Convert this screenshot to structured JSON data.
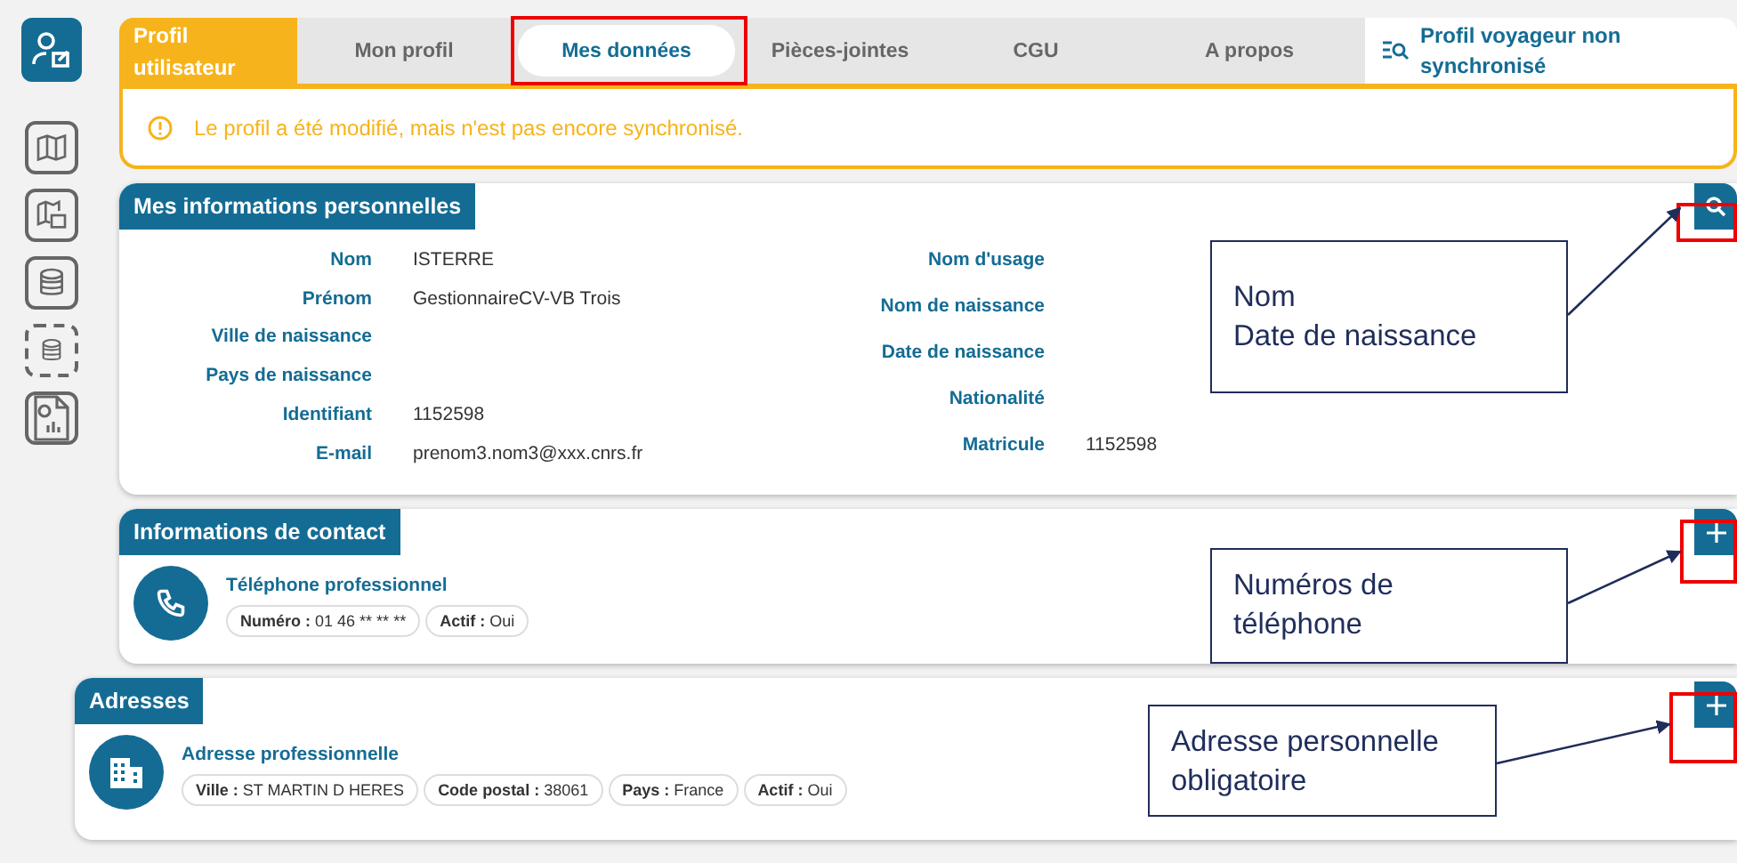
{
  "sidebar": {
    "items": [
      {
        "kind": "user",
        "selected": true
      },
      {
        "kind": "map",
        "selected": false
      },
      {
        "kind": "calendar",
        "selected": false
      },
      {
        "kind": "coins",
        "selected": false
      },
      {
        "kind": "coins-dashed",
        "selected": false
      },
      {
        "kind": "report",
        "selected": false
      }
    ]
  },
  "header": {
    "title": "Profil utilisateur",
    "tabs": [
      {
        "label": "Mon profil",
        "selected": false,
        "highlighted": false
      },
      {
        "label": "Mes données",
        "selected": true,
        "highlighted": true
      },
      {
        "label": "Pièces-jointes",
        "selected": false,
        "highlighted": false
      },
      {
        "label": "CGU",
        "selected": false,
        "highlighted": false
      },
      {
        "label": "A propos",
        "selected": false,
        "highlighted": false
      }
    ],
    "status": "Profil voyageur non synchronisé"
  },
  "alert": {
    "message": "Le profil a été modifié, mais n'est pas encore synchronisé."
  },
  "personal": {
    "title": "Mes informations personnelles",
    "action": {
      "kind": "search",
      "highlighted": true
    },
    "left": [
      {
        "label": "Nom",
        "value": "ISTERRE"
      },
      {
        "label": "Prénom",
        "value": "GestionnaireCV-VB Trois"
      },
      {
        "label": "Ville de naissance"
      },
      {
        "label": "Pays de naissance"
      },
      {
        "label": "Identifiant",
        "value": "1152598"
      },
      {
        "label": "E-mail",
        "value": "prenom3.nom3@xxx.cnrs.fr"
      }
    ],
    "right": [
      {
        "label": "Nom d'usage"
      },
      {
        "label": "Nom de naissance"
      },
      {
        "label": "Date de naissance"
      },
      {
        "label": "Nationalité"
      },
      {
        "label": "Matricule",
        "value": "1152598"
      }
    ]
  },
  "contact": {
    "title": "Informations de contact",
    "action": {
      "kind": "add",
      "highlighted": true
    },
    "entry": {
      "kind": "phone",
      "title": "Téléphone professionnel",
      "fields": [
        {
          "label": "Numéro :",
          "value": "01 46 ** ** **"
        },
        {
          "label": "Actif :",
          "value": "Oui"
        }
      ]
    }
  },
  "addresses": {
    "title": "Adresses",
    "action": {
      "kind": "add",
      "highlighted": true
    },
    "entry": {
      "kind": "building",
      "title": "Adresse professionnelle",
      "fields": [
        {
          "label": "Ville :",
          "value": "ST MARTIN D HERES"
        },
        {
          "label": "Code postal :",
          "value": "38061"
        },
        {
          "label": "Pays :",
          "value": "France"
        },
        {
          "label": "Actif :",
          "value": "Oui"
        }
      ]
    }
  },
  "annotations": [
    {
      "lines": [
        "Nom",
        "Date de naissance"
      ]
    },
    {
      "lines": [
        "Numéros de",
        "téléphone"
      ]
    },
    {
      "lines": [
        "Adresse personnelle",
        "obligatoire"
      ]
    }
  ]
}
